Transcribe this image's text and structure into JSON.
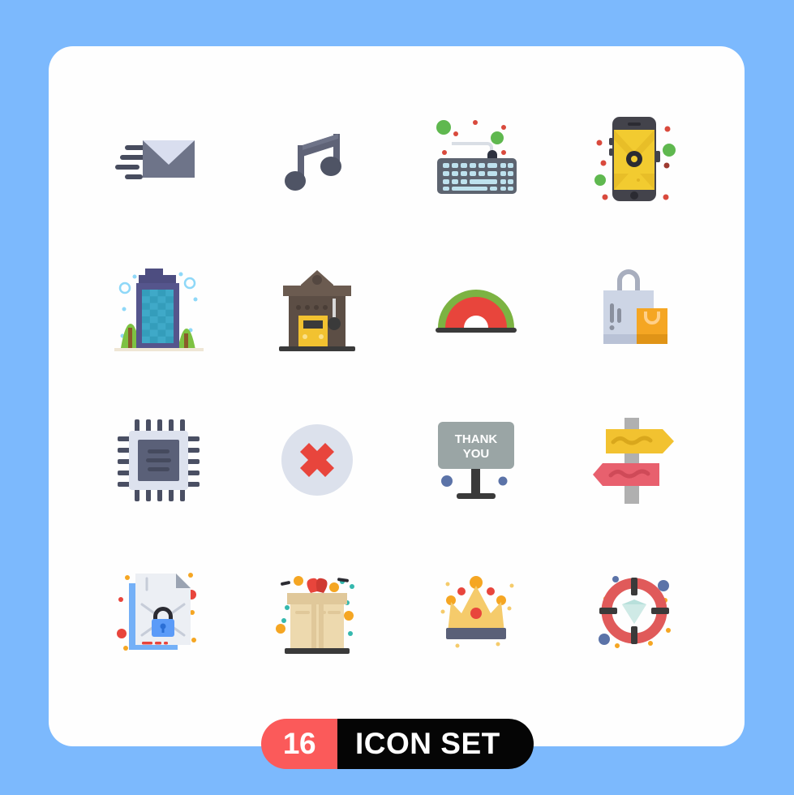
{
  "page": {
    "background_color": "#7CB9FD",
    "card_color": "#FEFEFE"
  },
  "badge": {
    "count": "16",
    "label": "ICON SET",
    "count_bg": "#FB5A5A",
    "label_bg": "#050505",
    "text_color": "#FFFFFF"
  },
  "icons": [
    {
      "name": "send-mail-icon",
      "label": "Send Mail",
      "row": 1,
      "col": 1,
      "colors": [
        "#D9DEEF",
        "#6E7489",
        "#474C5E"
      ]
    },
    {
      "name": "music-note-icon",
      "label": "Music Note",
      "row": 1,
      "col": 2,
      "colors": [
        "#5F6377",
        "#4F5465"
      ]
    },
    {
      "name": "keyboard-icon",
      "label": "Keyboard",
      "row": 1,
      "col": 3,
      "colors": [
        "#5D6470",
        "#A8D5E5",
        "#4CAF50",
        "#E84C3D"
      ]
    },
    {
      "name": "mobile-mail-icon",
      "label": "Mobile Mail",
      "row": 1,
      "col": 4,
      "colors": [
        "#43434B",
        "#F2CB30",
        "#4CAF50",
        "#E84C3D"
      ]
    },
    {
      "name": "office-building-icon",
      "label": "Office Building",
      "row": 2,
      "col": 1,
      "colors": [
        "#55558C",
        "#3FA9C8",
        "#7DC242",
        "#8ED8F8"
      ]
    },
    {
      "name": "train-station-icon",
      "label": "Train Station",
      "row": 2,
      "col": 2,
      "colors": [
        "#6B5B50",
        "#F2C230",
        "#3A3A3A"
      ]
    },
    {
      "name": "watermelon-icon",
      "label": "Watermelon",
      "row": 2,
      "col": 3,
      "colors": [
        "#7CB342",
        "#E8453C",
        "#3A3A3A"
      ]
    },
    {
      "name": "shopping-bags-icon",
      "label": "Shopping Bags",
      "row": 2,
      "col": 4,
      "colors": [
        "#CDD5E5",
        "#F5A623",
        "#9AA0AE"
      ]
    },
    {
      "name": "cpu-processor-icon",
      "label": "CPU Processor",
      "row": 3,
      "col": 1,
      "colors": [
        "#DDE2EE",
        "#5A6078",
        "#3A3F4F"
      ]
    },
    {
      "name": "cancel-icon",
      "label": "Cancel",
      "row": 3,
      "col": 2,
      "colors": [
        "#DCE1EC",
        "#E8453C"
      ]
    },
    {
      "name": "thank-you-sign-icon",
      "label": "Thank You Sign",
      "row": 3,
      "col": 3,
      "colors": [
        "#9AA5A5",
        "#3A3A3A",
        "#5B73A8"
      ]
    },
    {
      "name": "direction-signpost-icon",
      "label": "Direction Signpost",
      "row": 3,
      "col": 4,
      "colors": [
        "#B0B0B0",
        "#F2C230",
        "#E8606E"
      ]
    },
    {
      "name": "secure-document-icon",
      "label": "Secure Document",
      "row": 4,
      "col": 1,
      "colors": [
        "#ECEFF4",
        "#74B0F7",
        "#5B9BF8",
        "#E8453C"
      ]
    },
    {
      "name": "gift-box-icon",
      "label": "Gift Box",
      "row": 4,
      "col": 2,
      "colors": [
        "#EDD9AE",
        "#E0C89A",
        "#E8453C",
        "#F5A623",
        "#35B8AE"
      ]
    },
    {
      "name": "crown-icon",
      "label": "Crown",
      "row": 4,
      "col": 3,
      "colors": [
        "#F5CB6B",
        "#E8453C",
        "#F5A623",
        "#5A6078"
      ]
    },
    {
      "name": "target-diamond-icon",
      "label": "Target Diamond",
      "row": 4,
      "col": 4,
      "colors": [
        "#E05A5A",
        "#3A3A3A",
        "#B8E0DB",
        "#5B73A8"
      ]
    }
  ]
}
